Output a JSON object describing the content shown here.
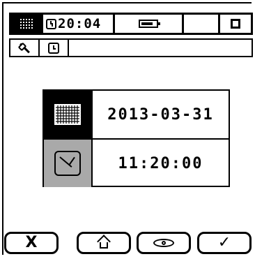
{
  "status_bar": {
    "time": "20:04",
    "icons": [
      "menu-grid-icon",
      "clock-icon",
      "battery-icon",
      "stop-icon"
    ]
  },
  "tabs": [
    {
      "icon": "wrench-icon"
    },
    {
      "icon": "clock-icon"
    }
  ],
  "datetime": {
    "date": "2013-03-31",
    "time": "11:20:00",
    "date_icon": "calendar-icon",
    "time_icon": "clock-icon"
  },
  "buttons": [
    {
      "label": "X",
      "icon": "close-icon"
    },
    {
      "icon": "home-icon"
    },
    {
      "icon": "eye-icon"
    },
    {
      "label": "✓",
      "icon": "check-icon"
    }
  ],
  "colors": {
    "foreground": "#000000",
    "background": "#ffffff",
    "gray_box": "#a9a9a9"
  }
}
